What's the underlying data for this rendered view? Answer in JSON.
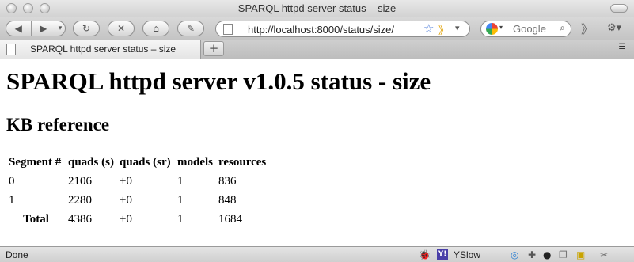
{
  "window": {
    "title": "SPARQL httpd server status – size"
  },
  "toolbar": {
    "back_icon": "◀",
    "forward_icon": "▶",
    "dropdown_icon": "▾",
    "reload_icon": "↻",
    "stop_icon": "✕",
    "home_icon": "⌂",
    "evernote_icon": "✎",
    "url": "http://localhost:8000/status/size/",
    "bookmark_icon": "☆",
    "rss_icon": "》",
    "search_placeholder": "Google",
    "search_icon": "⌕",
    "more_icon": "》",
    "gear_icon": "⚙▾"
  },
  "tabs": [
    {
      "title": "SPARQL httpd server status – size"
    }
  ],
  "tabstrip": {
    "new_tab_label": "+",
    "tab_list_icon": "☰"
  },
  "page": {
    "heading": "SPARQL httpd server v1.0.5 status - size",
    "subheading": "KB reference",
    "table": {
      "columns": [
        "Segment #",
        "quads (s)",
        "quads (sr)",
        "models",
        "resources"
      ],
      "rows": [
        [
          "0",
          "2106",
          "+0",
          "1",
          "836"
        ],
        [
          "1",
          "2280",
          "+0",
          "1",
          "848"
        ]
      ],
      "total_row": [
        "Total",
        "4386",
        "+0",
        "1",
        "1684"
      ]
    }
  },
  "statusbar": {
    "text": "Done",
    "yslow_label": "YSlow",
    "yslow_logo": "Y!"
  },
  "colors": {
    "link_blue": "#3b6fd6",
    "yslow_purple": "#4a3fa8"
  }
}
